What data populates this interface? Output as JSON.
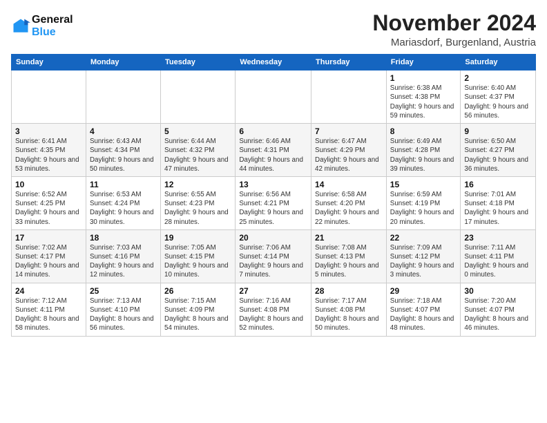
{
  "header": {
    "logo_line1": "General",
    "logo_line2": "Blue",
    "month": "November 2024",
    "location": "Mariasdorf, Burgenland, Austria"
  },
  "days_of_week": [
    "Sunday",
    "Monday",
    "Tuesday",
    "Wednesday",
    "Thursday",
    "Friday",
    "Saturday"
  ],
  "weeks": [
    [
      {
        "day": "",
        "info": ""
      },
      {
        "day": "",
        "info": ""
      },
      {
        "day": "",
        "info": ""
      },
      {
        "day": "",
        "info": ""
      },
      {
        "day": "",
        "info": ""
      },
      {
        "day": "1",
        "info": "Sunrise: 6:38 AM\nSunset: 4:38 PM\nDaylight: 9 hours and 59 minutes."
      },
      {
        "day": "2",
        "info": "Sunrise: 6:40 AM\nSunset: 4:37 PM\nDaylight: 9 hours and 56 minutes."
      }
    ],
    [
      {
        "day": "3",
        "info": "Sunrise: 6:41 AM\nSunset: 4:35 PM\nDaylight: 9 hours and 53 minutes."
      },
      {
        "day": "4",
        "info": "Sunrise: 6:43 AM\nSunset: 4:34 PM\nDaylight: 9 hours and 50 minutes."
      },
      {
        "day": "5",
        "info": "Sunrise: 6:44 AM\nSunset: 4:32 PM\nDaylight: 9 hours and 47 minutes."
      },
      {
        "day": "6",
        "info": "Sunrise: 6:46 AM\nSunset: 4:31 PM\nDaylight: 9 hours and 44 minutes."
      },
      {
        "day": "7",
        "info": "Sunrise: 6:47 AM\nSunset: 4:29 PM\nDaylight: 9 hours and 42 minutes."
      },
      {
        "day": "8",
        "info": "Sunrise: 6:49 AM\nSunset: 4:28 PM\nDaylight: 9 hours and 39 minutes."
      },
      {
        "day": "9",
        "info": "Sunrise: 6:50 AM\nSunset: 4:27 PM\nDaylight: 9 hours and 36 minutes."
      }
    ],
    [
      {
        "day": "10",
        "info": "Sunrise: 6:52 AM\nSunset: 4:25 PM\nDaylight: 9 hours and 33 minutes."
      },
      {
        "day": "11",
        "info": "Sunrise: 6:53 AM\nSunset: 4:24 PM\nDaylight: 9 hours and 30 minutes."
      },
      {
        "day": "12",
        "info": "Sunrise: 6:55 AM\nSunset: 4:23 PM\nDaylight: 9 hours and 28 minutes."
      },
      {
        "day": "13",
        "info": "Sunrise: 6:56 AM\nSunset: 4:21 PM\nDaylight: 9 hours and 25 minutes."
      },
      {
        "day": "14",
        "info": "Sunrise: 6:58 AM\nSunset: 4:20 PM\nDaylight: 9 hours and 22 minutes."
      },
      {
        "day": "15",
        "info": "Sunrise: 6:59 AM\nSunset: 4:19 PM\nDaylight: 9 hours and 20 minutes."
      },
      {
        "day": "16",
        "info": "Sunrise: 7:01 AM\nSunset: 4:18 PM\nDaylight: 9 hours and 17 minutes."
      }
    ],
    [
      {
        "day": "17",
        "info": "Sunrise: 7:02 AM\nSunset: 4:17 PM\nDaylight: 9 hours and 14 minutes."
      },
      {
        "day": "18",
        "info": "Sunrise: 7:03 AM\nSunset: 4:16 PM\nDaylight: 9 hours and 12 minutes."
      },
      {
        "day": "19",
        "info": "Sunrise: 7:05 AM\nSunset: 4:15 PM\nDaylight: 9 hours and 10 minutes."
      },
      {
        "day": "20",
        "info": "Sunrise: 7:06 AM\nSunset: 4:14 PM\nDaylight: 9 hours and 7 minutes."
      },
      {
        "day": "21",
        "info": "Sunrise: 7:08 AM\nSunset: 4:13 PM\nDaylight: 9 hours and 5 minutes."
      },
      {
        "day": "22",
        "info": "Sunrise: 7:09 AM\nSunset: 4:12 PM\nDaylight: 9 hours and 3 minutes."
      },
      {
        "day": "23",
        "info": "Sunrise: 7:11 AM\nSunset: 4:11 PM\nDaylight: 9 hours and 0 minutes."
      }
    ],
    [
      {
        "day": "24",
        "info": "Sunrise: 7:12 AM\nSunset: 4:11 PM\nDaylight: 8 hours and 58 minutes."
      },
      {
        "day": "25",
        "info": "Sunrise: 7:13 AM\nSunset: 4:10 PM\nDaylight: 8 hours and 56 minutes."
      },
      {
        "day": "26",
        "info": "Sunrise: 7:15 AM\nSunset: 4:09 PM\nDaylight: 8 hours and 54 minutes."
      },
      {
        "day": "27",
        "info": "Sunrise: 7:16 AM\nSunset: 4:08 PM\nDaylight: 8 hours and 52 minutes."
      },
      {
        "day": "28",
        "info": "Sunrise: 7:17 AM\nSunset: 4:08 PM\nDaylight: 8 hours and 50 minutes."
      },
      {
        "day": "29",
        "info": "Sunrise: 7:18 AM\nSunset: 4:07 PM\nDaylight: 8 hours and 48 minutes."
      },
      {
        "day": "30",
        "info": "Sunrise: 7:20 AM\nSunset: 4:07 PM\nDaylight: 8 hours and 46 minutes."
      }
    ]
  ]
}
